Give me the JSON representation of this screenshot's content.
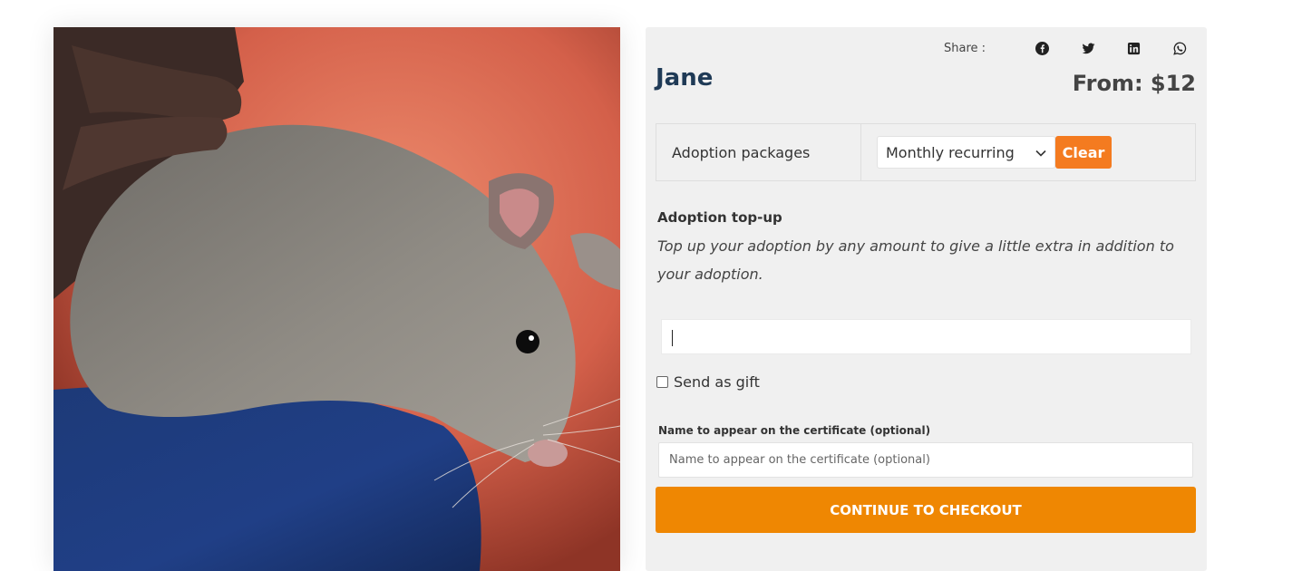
{
  "product": {
    "name": "Jane",
    "price_label": "From: $12"
  },
  "share": {
    "label": "Share :",
    "icons": [
      "facebook-icon",
      "twitter-icon",
      "linkedin-icon",
      "whatsapp-icon"
    ]
  },
  "packages": {
    "label": "Adoption packages",
    "selected": "Monthly recurring",
    "clear_label": "Clear"
  },
  "topup": {
    "heading": "Adoption top-up",
    "description": "Top up your adoption by any amount to give a little extra in addition to your adoption.",
    "value": ""
  },
  "gift": {
    "label": "Send as gift",
    "checked": false
  },
  "certificate": {
    "label": "Name to appear on the certificate (optional)",
    "placeholder": "Name to appear on the certificate (optional)"
  },
  "checkout": {
    "label": "CONTINUE TO CHECKOUT"
  },
  "colors": {
    "accent": "#ef8702",
    "clear_button": "#f47b20",
    "title": "#1f3a56",
    "panel": "#f0f0f0"
  }
}
